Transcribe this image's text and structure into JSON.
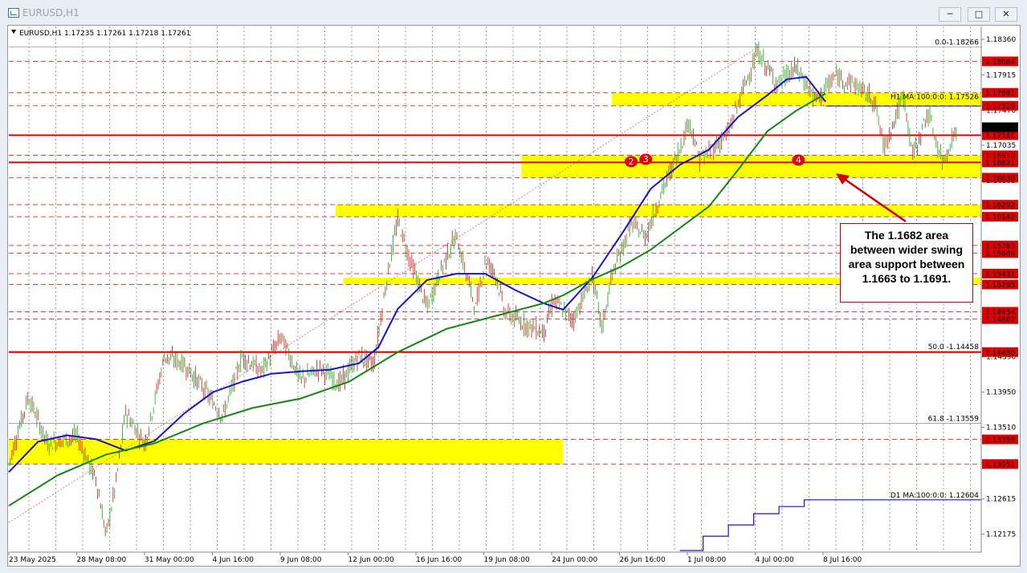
{
  "window": {
    "title": "EURUSD,H1",
    "buttons": {
      "minimize": "─",
      "restore": "□",
      "close": "✕"
    }
  },
  "chart_info": "EURUSD,H1  1.17235 1.17261 1.17218 1.17261",
  "callout_text": "The 1.1682 area between wider swing area support between 1.1663 to 1.1691.",
  "chart_data": {
    "type": "line",
    "symbol": "EURUSD",
    "timeframe": "H1",
    "ylim": [
      1.1195,
      1.1852
    ],
    "current_price": "1.17261",
    "y_price_labels": [
      "1.18360",
      "1.17915",
      "1.17470",
      "1.17035",
      "1.16595",
      "1.16155",
      "1.15715",
      "1.15275",
      "1.14835",
      "1.14390",
      "1.13950",
      "1.13510",
      "1.13070",
      "1.12615",
      "1.12175"
    ],
    "x_labels": [
      "23 May 2025",
      "28 May 08:00",
      "31 May 00:00",
      "4 Jun 16:00",
      "9 Jun 08:00",
      "12 Jun 00:00",
      "16 Jun 16:00",
      "19 Jun 08:00",
      "24 Jun 00:00",
      "26 Jun 16:00",
      "1 Jul 08:00",
      "4 Jul 00:00",
      "8 Jul 16:00"
    ],
    "horizontal_levels": [
      {
        "label": "1.18084",
        "value": 1.18084,
        "style": "dashed"
      },
      {
        "label": "1.17691",
        "value": 1.17691,
        "style": "dashed"
      },
      {
        "label": "1.17529",
        "value": 1.17529,
        "style": "dashed"
      },
      {
        "label": "1.17161",
        "value": 1.17161,
        "style": "solid"
      },
      {
        "label": "1.16910",
        "value": 1.1691,
        "style": "dashed"
      },
      {
        "label": "1.16821",
        "value": 1.16821,
        "style": "solid"
      },
      {
        "label": "1.16630",
        "value": 1.1663,
        "style": "dashed"
      },
      {
        "label": "1.16292",
        "value": 1.16292,
        "style": "dashed"
      },
      {
        "label": "1.16142",
        "value": 1.16142,
        "style": "dashed"
      },
      {
        "label": "1.15783",
        "value": 1.15783,
        "style": "dashed"
      },
      {
        "label": "1.15688",
        "value": 1.15688,
        "style": "dashed"
      },
      {
        "label": "1.15431",
        "value": 1.15431,
        "style": "dashed"
      },
      {
        "label": "1.15295",
        "value": 1.15295,
        "style": "dashed"
      },
      {
        "label": "1.14954",
        "value": 1.14954,
        "style": "dashed"
      },
      {
        "label": "1.14862",
        "value": 1.14862,
        "style": "dashed"
      },
      {
        "label": "1.14450",
        "value": 1.1445,
        "style": "solid"
      },
      {
        "label": "1.13359",
        "value": 1.13359,
        "style": "dashed"
      },
      {
        "label": "1.13051",
        "value": 1.13051,
        "style": "dashed"
      }
    ],
    "fib_levels": [
      {
        "label": "0.0-1.18266",
        "value": 1.18266
      },
      {
        "label": "50.0 -1.14458",
        "value": 1.14458
      },
      {
        "label": "61.8 -1.13559",
        "value": 1.13559
      }
    ],
    "zones": [
      {
        "from": 1.17529,
        "to": 1.17691,
        "start_x": 0.62
      },
      {
        "from": 1.1663,
        "to": 1.1691,
        "start_x": 0.527
      },
      {
        "from": 1.16142,
        "to": 1.16292,
        "start_x": 0.336
      },
      {
        "from": 1.15295,
        "to": 1.1538,
        "start_x": 0.344
      },
      {
        "from": 1.13051,
        "to": 1.13359,
        "start_x": 0.0,
        "end_x": 0.57
      }
    ],
    "series": [
      {
        "name": "H1 MA:100:0:0: 1.17526",
        "label_value": "1.17526",
        "color": "#1515d0",
        "x": [
          0,
          0.03,
          0.06,
          0.09,
          0.12,
          0.15,
          0.18,
          0.21,
          0.24,
          0.27,
          0.3,
          0.33,
          0.36,
          0.38,
          0.4,
          0.43,
          0.46,
          0.49,
          0.52,
          0.55,
          0.57,
          0.6,
          0.63,
          0.66,
          0.69,
          0.72,
          0.75,
          0.78,
          0.8,
          0.82,
          0.84
        ],
        "y": [
          1.1295,
          1.1333,
          1.1341,
          1.1336,
          1.1322,
          1.1334,
          1.1368,
          1.1395,
          1.1408,
          1.1418,
          1.1421,
          1.1423,
          1.1431,
          1.1451,
          1.1499,
          1.1535,
          1.1543,
          1.1543,
          1.1523,
          1.1506,
          1.1498,
          1.1538,
          1.1592,
          1.1649,
          1.1679,
          1.1698,
          1.1739,
          1.1766,
          1.1786,
          1.1789,
          1.1758
        ]
      },
      {
        "name": "",
        "color": "#118811",
        "x": [
          0,
          0.05,
          0.1,
          0.15,
          0.2,
          0.25,
          0.3,
          0.35,
          0.4,
          0.45,
          0.5,
          0.55,
          0.57,
          0.6,
          0.63,
          0.66,
          0.69,
          0.72,
          0.75,
          0.78,
          0.81,
          0.84
        ],
        "y": [
          1.1253,
          1.1291,
          1.1317,
          1.1331,
          1.1356,
          1.1375,
          1.1387,
          1.1408,
          1.1445,
          1.1474,
          1.149,
          1.1506,
          1.1516,
          1.1536,
          1.1552,
          1.1573,
          1.16,
          1.1627,
          1.1673,
          1.1721,
          1.1747,
          1.1768
        ]
      },
      {
        "name": "D1 MA:100:0:0: 1.12604",
        "label_value": "1.12604",
        "color": "#1515d0",
        "x": [
          0.69,
          0.714,
          0.714,
          0.74,
          0.74,
          0.766,
          0.766,
          0.792,
          0.792,
          0.818,
          0.818,
          1.0
        ],
        "y": [
          1.1197,
          1.1197,
          1.1215,
          1.1215,
          1.1229,
          1.1229,
          1.1243,
          1.1243,
          1.1252,
          1.1252,
          1.12604,
          1.12604
        ]
      }
    ],
    "markers": [
      {
        "label": "2",
        "x": 0.64,
        "y": 1.1683
      },
      {
        "label": "3",
        "x": 0.655,
        "y": 1.1686
      },
      {
        "label": "4",
        "x": 0.812,
        "y": 1.1685
      }
    ]
  }
}
